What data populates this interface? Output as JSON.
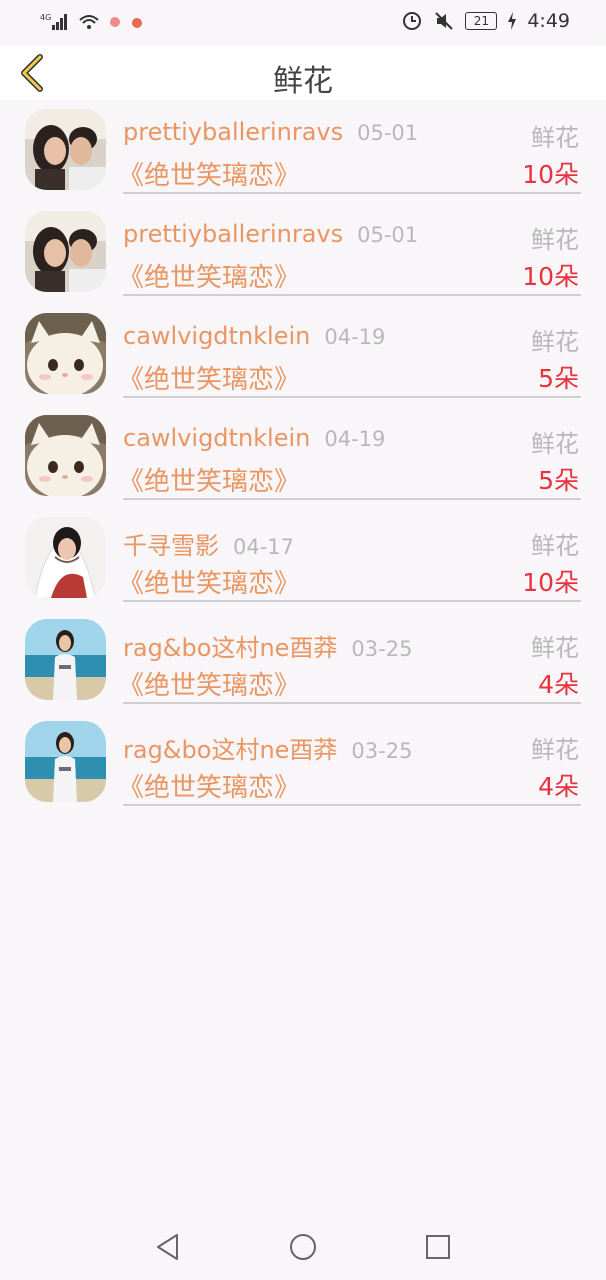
{
  "status_bar": {
    "network": "4G",
    "battery": "21",
    "time": "4:49"
  },
  "header": {
    "title": "鲜花",
    "back_icon": "chevron-left-icon"
  },
  "rows": [
    {
      "user": "prettiyballerinravs",
      "date": "05-01",
      "gift": "鲜花",
      "book": "《绝世笑璃恋》",
      "amount": "10朵",
      "avatar": "couple"
    },
    {
      "user": "prettiyballerinravs",
      "date": "05-01",
      "gift": "鲜花",
      "book": "《绝世笑璃恋》",
      "amount": "10朵",
      "avatar": "couple"
    },
    {
      "user": "cawlvigdtnklein",
      "date": "04-19",
      "gift": "鲜花",
      "book": "《绝世笑璃恋》",
      "amount": "5朵",
      "avatar": "cat"
    },
    {
      "user": "cawlvigdtnklein",
      "date": "04-19",
      "gift": "鲜花",
      "book": "《绝世笑璃恋》",
      "amount": "5朵",
      "avatar": "cat"
    },
    {
      "user": "千寻雪影",
      "date": "04-17",
      "gift": "鲜花",
      "book": "《绝世笑璃恋》",
      "amount": "10朵",
      "avatar": "woman-white"
    },
    {
      "user": "rag&bo这村ne酉莽",
      "date": "03-25",
      "gift": "鲜花",
      "book": "《绝世笑璃恋》",
      "amount": "4朵",
      "avatar": "beach"
    },
    {
      "user": "rag&bo这村ne酉莽",
      "date": "03-25",
      "gift": "鲜花",
      "book": "《绝世笑璃恋》",
      "amount": "4朵",
      "avatar": "beach"
    }
  ],
  "colors": {
    "username": "#e99663",
    "amount": "#e8323e",
    "muted": "#b8b8b8",
    "back_arrow": "#f2c94c"
  }
}
